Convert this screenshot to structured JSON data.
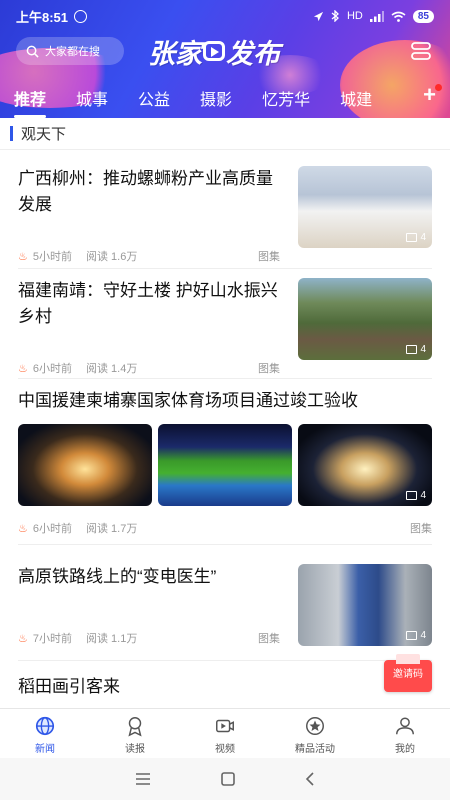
{
  "status_bar": {
    "time": "上午8:51",
    "network": "HD",
    "battery": "85"
  },
  "header": {
    "search_placeholder": "大家都在搜",
    "logo_text_left": "张家",
    "logo_text_right": "发布",
    "tabs": [
      {
        "label": "推荐",
        "active": true
      },
      {
        "label": "城事",
        "active": false
      },
      {
        "label": "公益",
        "active": false
      },
      {
        "label": "摄影",
        "active": false
      },
      {
        "label": "忆芳华",
        "active": false
      },
      {
        "label": "城建",
        "active": false
      }
    ],
    "more_label": "+"
  },
  "section": {
    "title": "观天下"
  },
  "feed": [
    {
      "title": "广西柳州：推动螺蛳粉产业高质量发展",
      "time": "5小时前",
      "reads": "阅读 1.6万",
      "type": "图集",
      "image_count": "4"
    },
    {
      "title": "福建南靖：守好土楼 护好山水振兴乡村",
      "time": "6小时前",
      "reads": "阅读 1.4万",
      "type": "图集",
      "image_count": "4"
    },
    {
      "title": "中国援建柬埔寨国家体育场项目通过竣工验收",
      "time": "6小时前",
      "reads": "阅读 1.7万",
      "type": "图集",
      "image_count": "4"
    },
    {
      "title": "高原铁路线上的“变电医生”",
      "time": "7小时前",
      "reads": "阅读 1.1万",
      "type": "图集",
      "image_count": "4"
    },
    {
      "title": "稻田画引客来"
    }
  ],
  "invite_button": "邀请码",
  "bottom_nav": [
    {
      "label": "新闻",
      "icon": "globe-icon",
      "active": true
    },
    {
      "label": "读报",
      "icon": "ribbon-icon",
      "active": false
    },
    {
      "label": "视频",
      "icon": "video-icon",
      "active": false
    },
    {
      "label": "精品活动",
      "icon": "activity-icon",
      "active": false
    },
    {
      "label": "我的",
      "icon": "user-icon",
      "active": false
    }
  ],
  "colors": {
    "accent": "#2f57e8",
    "hot": "#ff6a3a"
  }
}
